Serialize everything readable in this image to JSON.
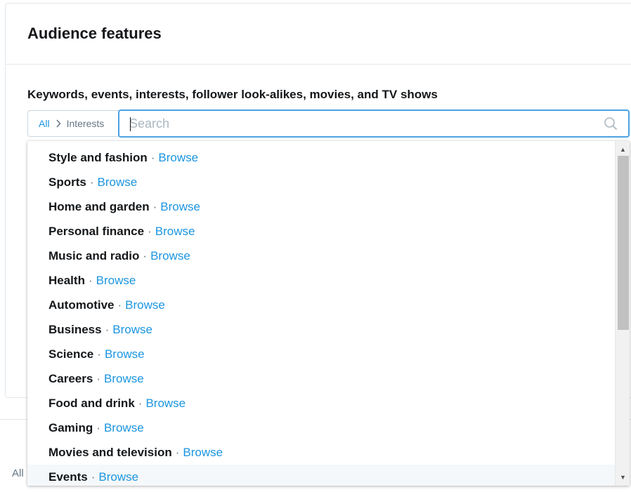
{
  "card": {
    "title": "Audience features"
  },
  "section": {
    "label": "Keywords, events, interests, follower look-alikes, movies, and TV shows"
  },
  "breadcrumb": {
    "root": "All",
    "separator_icon": "chevron-right-icon",
    "current": "Interests"
  },
  "search": {
    "placeholder": "Search",
    "value": "",
    "icon": "search-icon"
  },
  "background": {
    "bottom_left_label": "All"
  },
  "dropdown": {
    "separator": "·",
    "browse_label": "Browse",
    "hovered_index": 13,
    "items": [
      {
        "name": "Style and fashion"
      },
      {
        "name": "Sports"
      },
      {
        "name": "Home and garden"
      },
      {
        "name": "Personal finance"
      },
      {
        "name": "Music and radio"
      },
      {
        "name": "Health"
      },
      {
        "name": "Automotive"
      },
      {
        "name": "Business"
      },
      {
        "name": "Science"
      },
      {
        "name": "Careers"
      },
      {
        "name": "Food and drink"
      },
      {
        "name": "Gaming"
      },
      {
        "name": "Movies and television"
      },
      {
        "name": "Events"
      }
    ]
  },
  "colors": {
    "accent": "#1b95e0",
    "focus_border": "#4ba3e2",
    "text": "#14171a",
    "muted": "#657786",
    "border": "#e1e8ed"
  }
}
